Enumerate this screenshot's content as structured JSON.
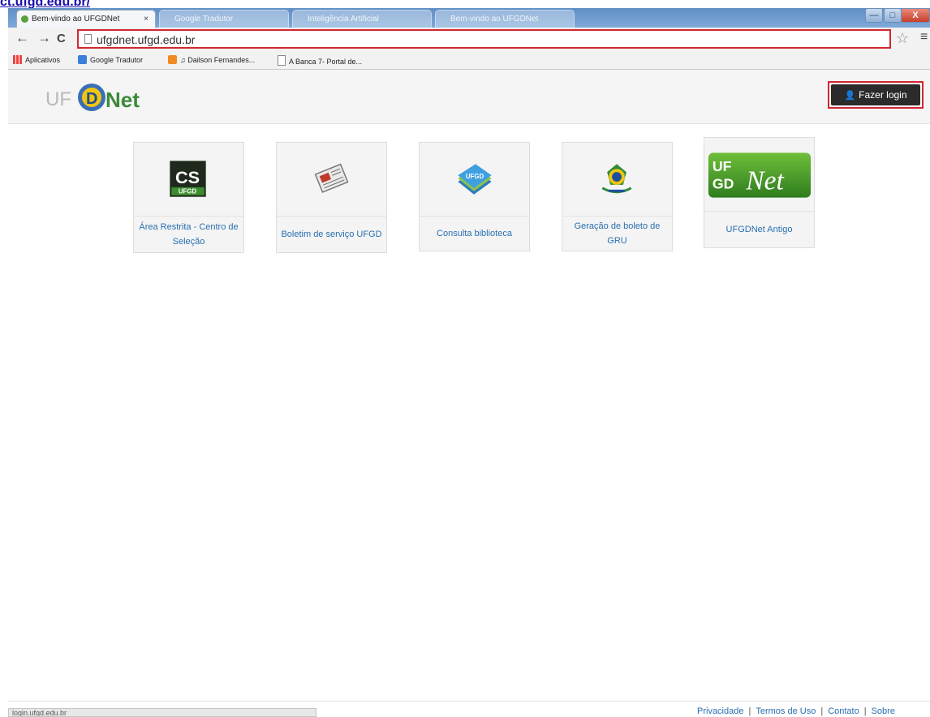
{
  "top_link": "ct.ufgd.edu.br/",
  "browser": {
    "active_tab": "Bem-vindo ao UFGDNet",
    "active_tab_close": "×",
    "other_tabs": [
      "Google Tradutor",
      "Inteligência Artificial",
      "Bem-vindo ao UFGDNet"
    ],
    "window_controls": {
      "minimize": "—",
      "maximize": "□",
      "close": "X"
    },
    "nav": {
      "back": "←",
      "forward": "→",
      "reload": "C"
    },
    "url": "ufgdnet.ufgd.edu.br",
    "star": "☆",
    "menu": "≡",
    "bookmarks": [
      "Aplicativos",
      "Google Tradutor",
      "♫ Dailson Fernandes...",
      "A Banca 7- Portal de..."
    ]
  },
  "header": {
    "logo_text": "UFGDNet",
    "login_label": "Fazer login",
    "login_icon": "user-icon"
  },
  "tiles": [
    {
      "label": "Área Restrita - Centro de Seleção",
      "icon": "cs-ufgd-icon"
    },
    {
      "label": "Boletim de serviço UFGD",
      "icon": "newspaper-icon"
    },
    {
      "label": "Consulta biblioteca",
      "icon": "books-icon"
    },
    {
      "label": "Geração de boleto de GRU",
      "icon": "brazil-coat-of-arms-icon"
    },
    {
      "label": "UFGDNet Antigo",
      "icon": "ufgdnet-old-logo-icon"
    }
  ],
  "icon_text": {
    "cs": "CS",
    "ufgd": "UFGD",
    "uf": "UF",
    "gd": "GD",
    "net": "Net"
  },
  "footer": {
    "status": "login.ufgd.edu.br",
    "links": [
      "Privacidade",
      "Termos de Uso",
      "Contato",
      "Sobre"
    ],
    "separator": "|"
  },
  "colors": {
    "highlight": "#d22630",
    "link": "#2a6fb0",
    "login_bg": "#2b2b2b"
  }
}
